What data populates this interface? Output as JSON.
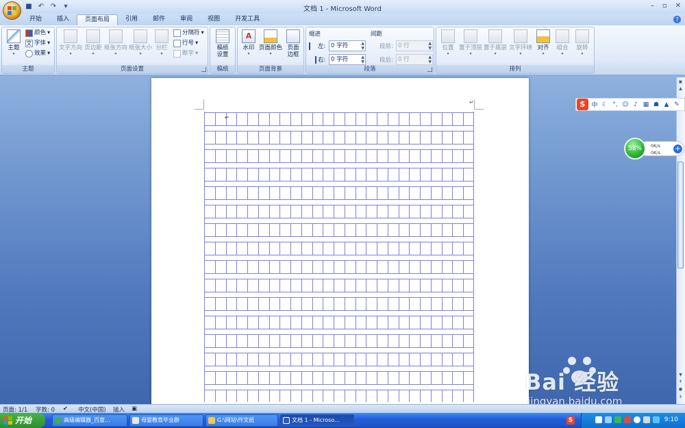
{
  "window": {
    "title": "文档 1 - Microsoft Word",
    "controls": [
      "–",
      "▫",
      "✕"
    ]
  },
  "tabs": [
    {
      "label": "开始",
      "active": false
    },
    {
      "label": "插入",
      "active": false
    },
    {
      "label": "页面布局",
      "active": true
    },
    {
      "label": "引用",
      "active": false
    },
    {
      "label": "邮件",
      "active": false
    },
    {
      "label": "审阅",
      "active": false
    },
    {
      "label": "视图",
      "active": false
    },
    {
      "label": "开发工具",
      "active": false
    }
  ],
  "ribbon": {
    "theme": {
      "label": "主题",
      "themes_btn": "主题",
      "colors": "颜色",
      "fonts": "字体",
      "effects": "效果"
    },
    "page_setup": {
      "label": "页面设置",
      "orientation": "文字方向",
      "margins": "页边距",
      "paper_orientation": "纸张方向",
      "size": "纸张大小",
      "columns": "分栏",
      "breaks": "分隔符",
      "line_numbers": "行号",
      "hyphenation": "断字"
    },
    "manuscript": {
      "label": "稿纸",
      "setup_line1": "稿纸",
      "setup_line2": "设置"
    },
    "page_background": {
      "label": "页面背景",
      "watermark": "水印",
      "page_color": "页面颜色",
      "borders_line1": "页面",
      "borders_line2": "边框"
    },
    "paragraph": {
      "label": "段落",
      "indent_title": "缩进",
      "spacing_title": "间距",
      "left_label": "左:",
      "right_label": "右:",
      "left_value": "0 字符",
      "right_value": "0 字符",
      "before_label": "段前:",
      "after_label": "段后:",
      "before_value": "0 行",
      "after_value": "0 行"
    },
    "arrange": {
      "label": "排列",
      "position": "位置",
      "bring_front": "置于顶层",
      "send_back": "置于底层",
      "text_wrap": "文字环绕",
      "align": "对齐",
      "group": "组合",
      "rotate": "旋转"
    }
  },
  "status": {
    "page": "页面: 1/1",
    "words": "字数: 0",
    "language": "中文(中国)",
    "mode": "插入"
  },
  "net_widget": {
    "percent": "58%",
    "up": "0K/s",
    "down": "0K/s"
  },
  "taskbar": {
    "start": "开始",
    "items": [
      {
        "label": "高级编辑器_百度...",
        "active": false
      },
      {
        "label": "母婴教育毕业群",
        "active": false
      },
      {
        "label": "G:\\网站\\作文纸",
        "active": false
      },
      {
        "label": "文档 1 - Microso...",
        "active": true
      }
    ],
    "clock": "9:10"
  },
  "watermark": {
    "word": "Bai 经验",
    "url": "jingyan.baidu.com"
  },
  "colors": {
    "grid_line": "#7b7fe0",
    "accent": "#245edb",
    "start_green": "#2f8f2f",
    "sogou_red": "#e8462a"
  }
}
